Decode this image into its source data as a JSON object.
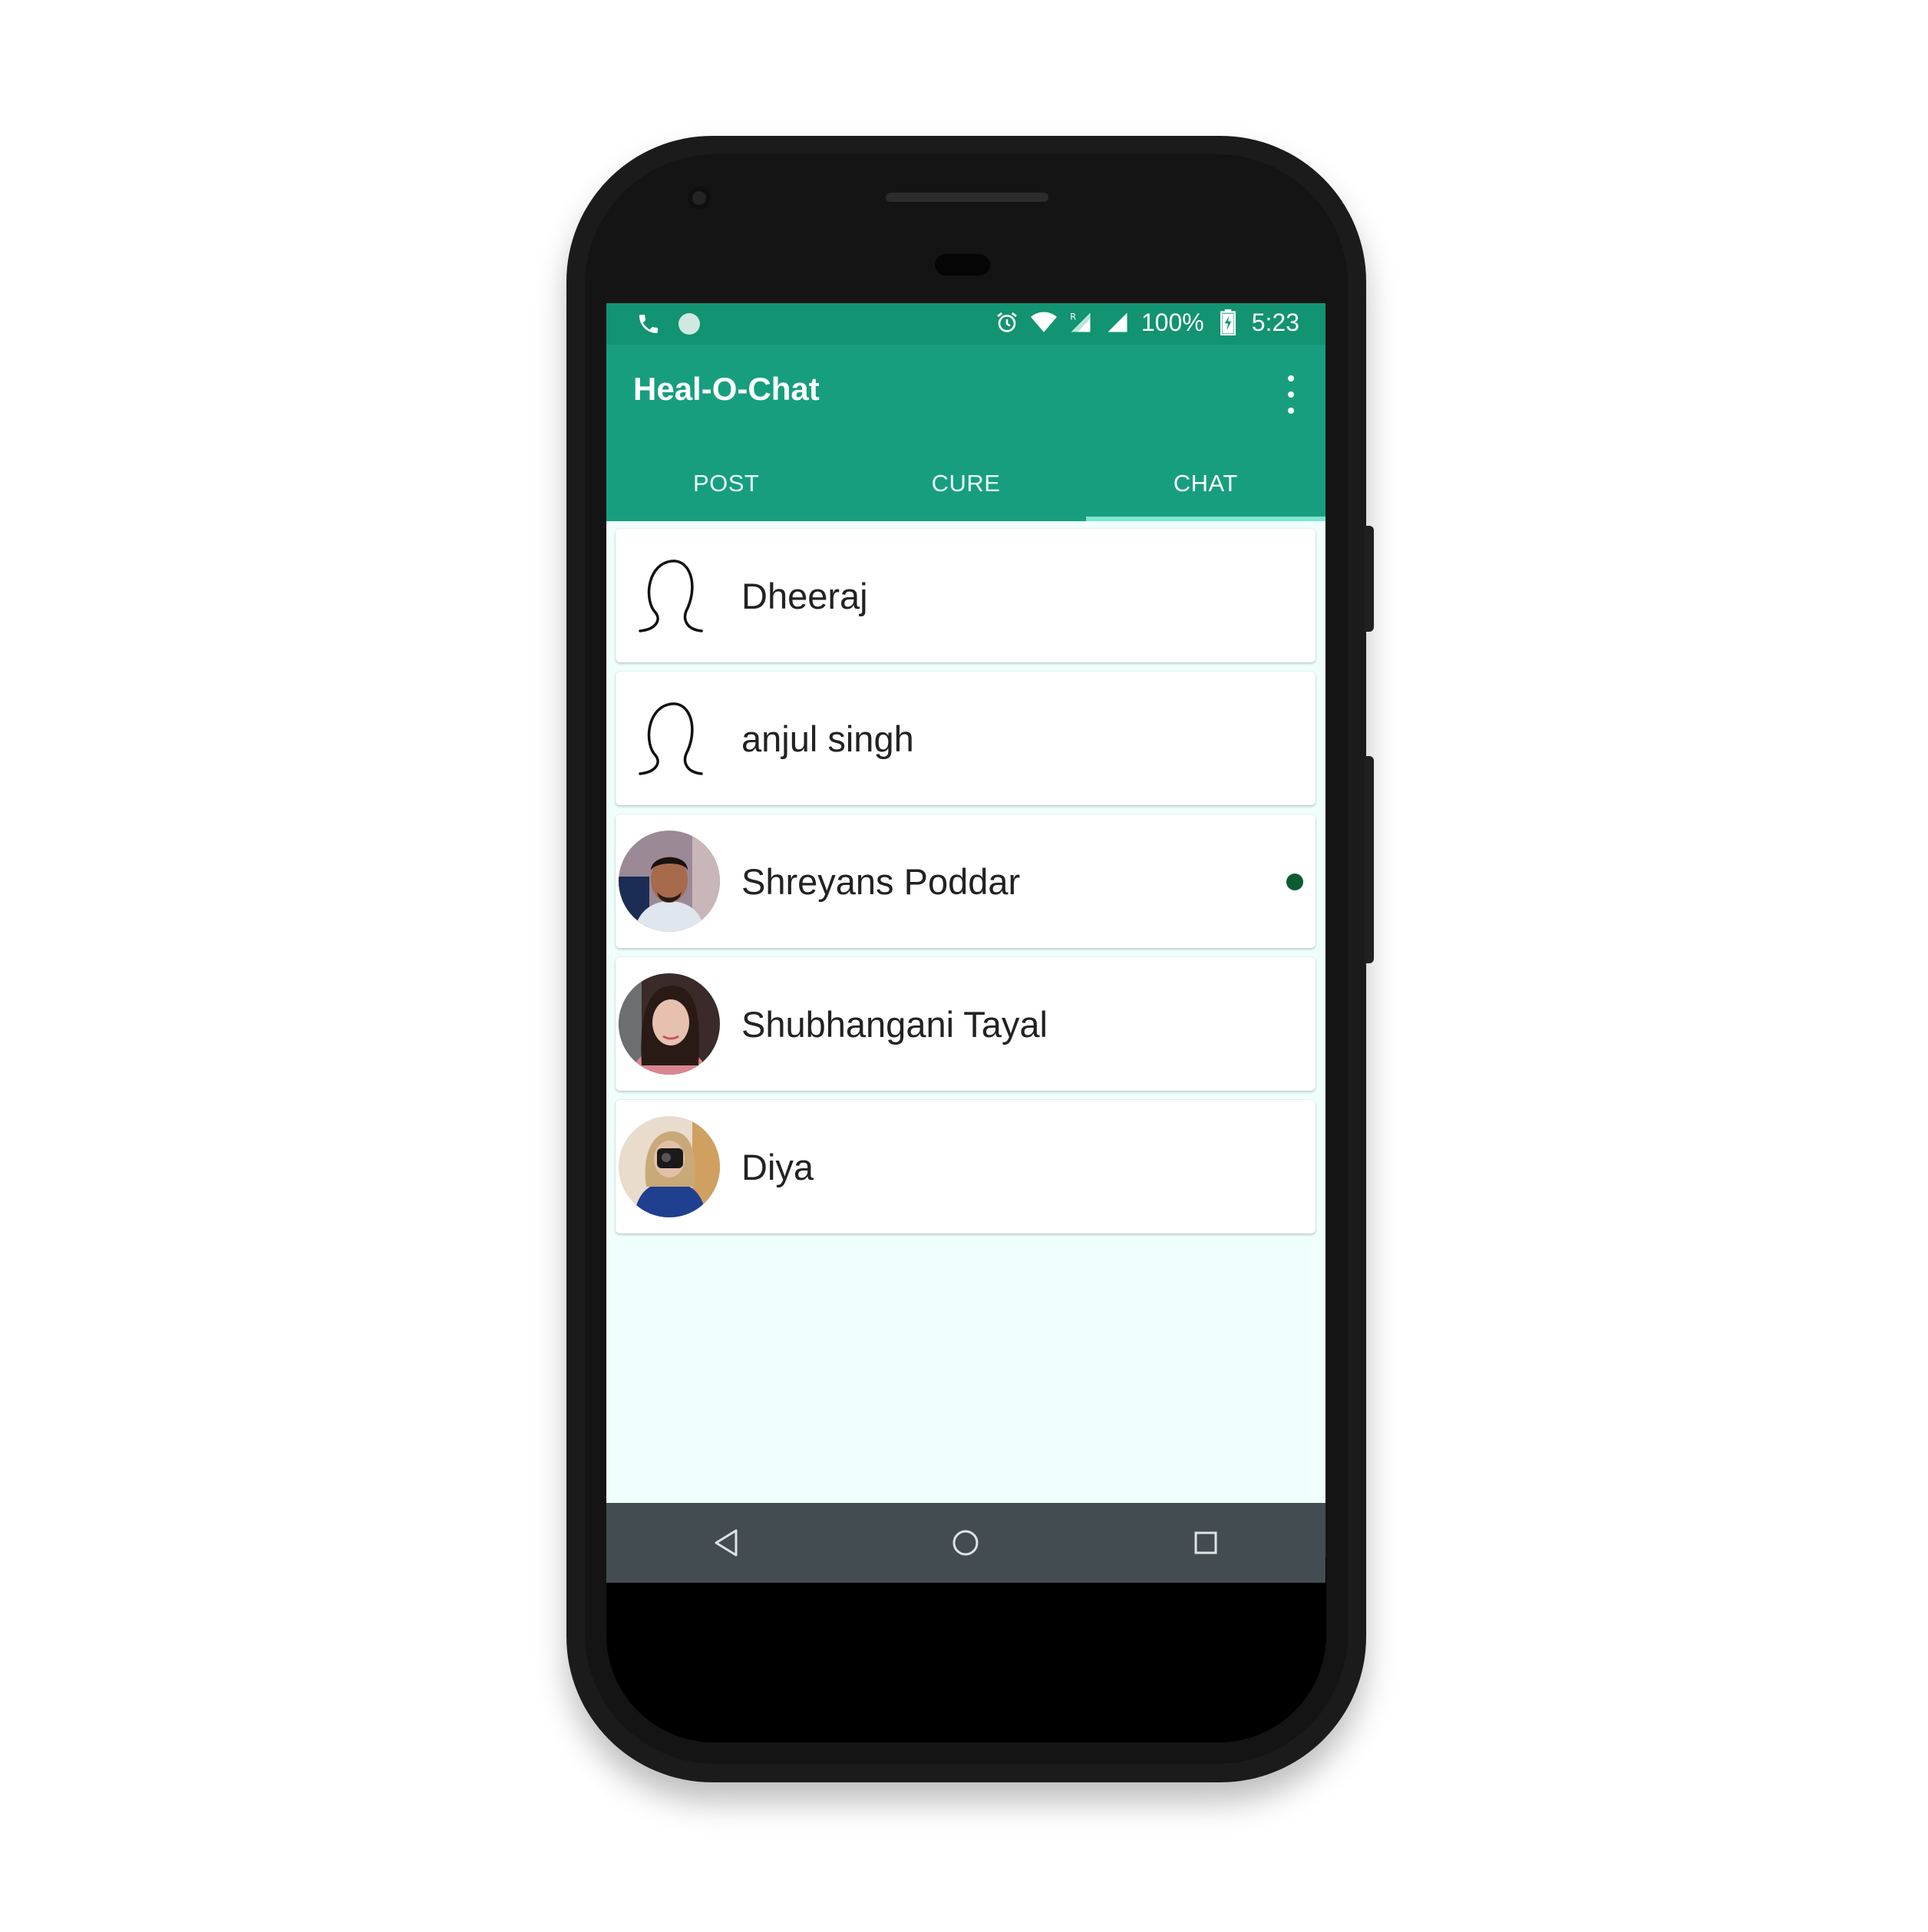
{
  "status_bar": {
    "icons_left": [
      "phone-icon",
      "status-dot-icon"
    ],
    "icons_right": [
      "alarm-icon",
      "wifi-icon",
      "roaming-signal-icon",
      "signal-icon",
      "battery-charging-icon"
    ],
    "battery": "100%",
    "time": "5:23"
  },
  "app_bar": {
    "title": "Heal-O-Chat",
    "overflow_icon": "more-vert-icon"
  },
  "tabs": [
    {
      "label": "POST",
      "active": false
    },
    {
      "label": "CURE",
      "active": false
    },
    {
      "label": "CHAT",
      "active": true
    }
  ],
  "chats": [
    {
      "name": "Dheeraj",
      "avatar": "default-person-outline",
      "online": false
    },
    {
      "name": "anjul singh",
      "avatar": "default-person-outline",
      "online": false
    },
    {
      "name": "Shreyans Poddar",
      "avatar": "photo",
      "online": true
    },
    {
      "name": "Shubhangani Tayal",
      "avatar": "photo",
      "online": false
    },
    {
      "name": "Diya",
      "avatar": "photo",
      "online": false
    }
  ],
  "colors": {
    "status_bar": "#129372",
    "app_bar": "#179e7f",
    "tab_indicator": "#7fe6d0",
    "screen_background": "#effffb",
    "online_dot": "#0d5c2f",
    "nav_bar": "#434d51"
  },
  "nav_bar": {
    "icons": [
      "back-icon",
      "home-icon",
      "recents-icon"
    ]
  }
}
